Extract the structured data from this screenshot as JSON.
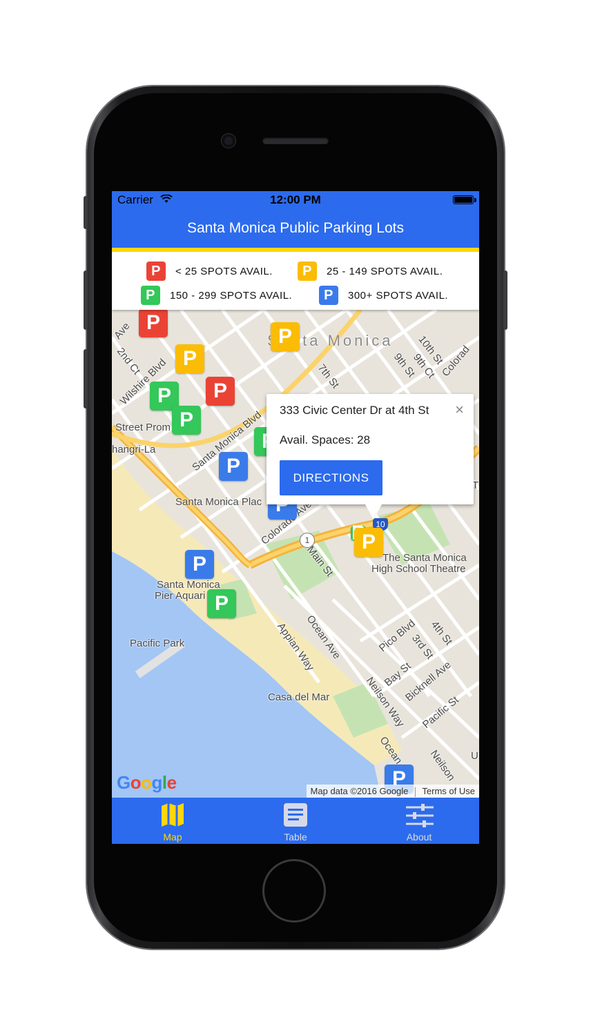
{
  "status_bar": {
    "carrier": "Carrier",
    "time": "12:00 PM"
  },
  "nav": {
    "title": "Santa Monica Public Parking Lots"
  },
  "legend": [
    {
      "label": "< 25 SPOTS AVAIL.",
      "color": "#ea4335",
      "glyph": "P"
    },
    {
      "label": "25 - 149 SPOTS AVAIL.",
      "color": "#fbbc05",
      "glyph": "P"
    },
    {
      "label": "150 - 299 SPOTS AVAIL.",
      "color": "#34c759",
      "glyph": "P"
    },
    {
      "label": "300+ SPOTS AVAIL.",
      "color": "#3a7bea",
      "glyph": "P"
    }
  ],
  "map": {
    "marker_glyph": "P",
    "labels": {
      "santa_monica": "Santa Monica",
      "tenth_st": "10th St",
      "ninth_st_a": "9th St",
      "ninth_st_b": "9th Ct",
      "colorado": "Colorad",
      "seventh_st": "7th St",
      "second_ct": "2nd Ct",
      "ave": "Ave",
      "wilshire": "Wilshire Blvd",
      "santa_monica_blvd": "Santa Monica Blvd",
      "street_prom": "Street Prom",
      "shangri_la": "hangri-La",
      "santa_monica_place": "Santa Monica Plac",
      "colorado_ave": "Colorado Ave",
      "main_st": "Main St",
      "route_1": "1",
      "route_10": "10",
      "hs_theatre_1": "The Santa Monica",
      "hs_theatre_2": "High School Theatre",
      "pier_aquarium_1": "Santa Monica",
      "pier_aquarium_2": "Pier Aquari",
      "pacific_park": "Pacific Park",
      "appian_way": "Appian Way",
      "ocean_ave": "Ocean Ave",
      "pico_blvd": "Pico Blvd",
      "fourth_st": "4th St",
      "third_st": "3rd St",
      "bay_st": "Bay St",
      "bicknell": "Bicknell Ave",
      "pacific_st": "Pacific St",
      "neilson_way": "Neilson Way",
      "casa_del_mar": "Casa del Mar",
      "ocean_2": "Ocean",
      "neilson_2": "Neilson",
      "edge_u": "U",
      "edge_t": "T"
    },
    "google_logo": "Google",
    "attribution": {
      "data": "Map data ©2016 Google",
      "terms": "Terms of Use"
    }
  },
  "popup": {
    "title": "333 Civic Center Dr at 4th St",
    "avail": "Avail. Spaces: 28",
    "button": "DIRECTIONS",
    "close": "×"
  },
  "tabs": [
    {
      "label": "Map",
      "icon": "map-icon",
      "active": true
    },
    {
      "label": "Table",
      "icon": "table-icon",
      "active": false
    },
    {
      "label": "About",
      "icon": "sliders-icon",
      "active": false
    }
  ],
  "colors": {
    "primary": "#2c6bed",
    "accent": "#ffd60a",
    "red": "#ea4335",
    "yellow": "#fbbc05",
    "green": "#34c759",
    "blue": "#3a7bea"
  }
}
